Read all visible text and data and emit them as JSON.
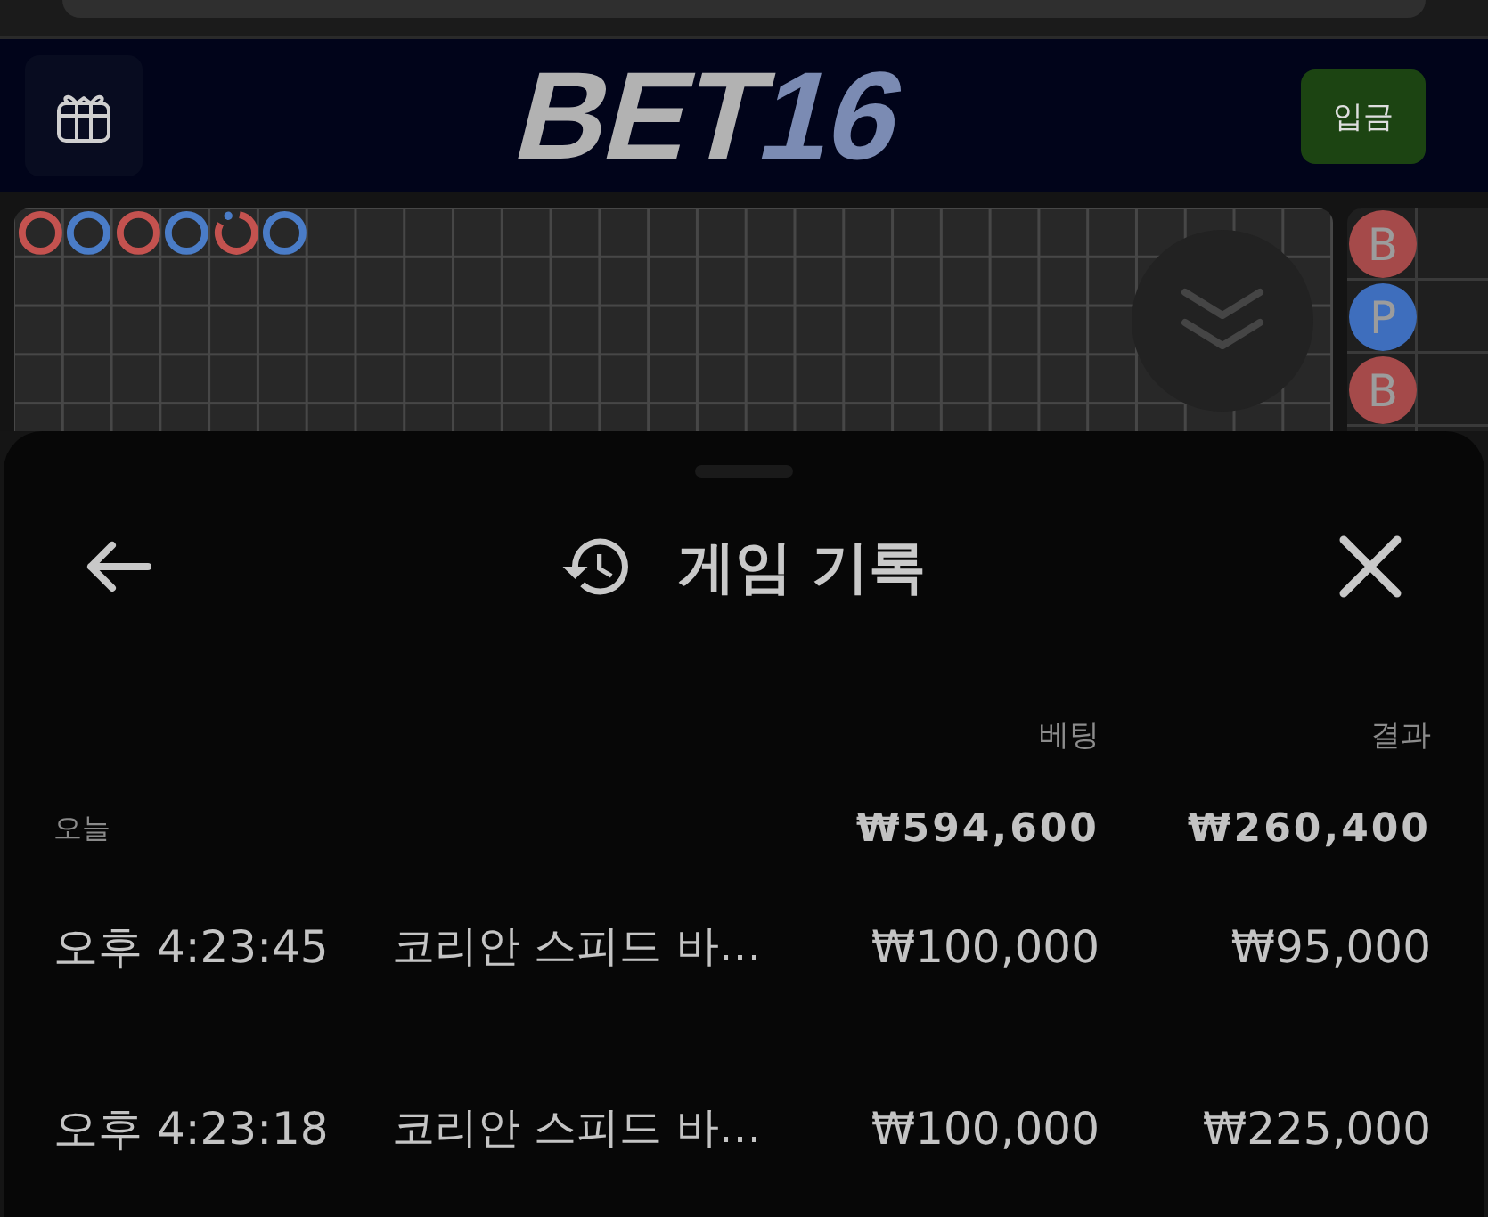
{
  "header": {
    "logo": [
      {
        "text": "BET",
        "kind": "primary"
      },
      {
        "text": "16",
        "kind": "accent"
      }
    ],
    "deposit_button": {
      "label": "입금"
    }
  },
  "big_road": {
    "marks": [
      {
        "color": "#c4524f",
        "pair": false
      },
      {
        "color": "#4a7cc7",
        "pair": false
      },
      {
        "color": "#c4524f",
        "pair": false
      },
      {
        "color": "#4a7cc7",
        "pair": false
      },
      {
        "color": "#c4524f",
        "pair": true
      },
      {
        "color": "#4a7cc7",
        "pair": false
      }
    ]
  },
  "bead_road": {
    "beads": [
      {
        "label": "B",
        "color": "#a54a4a"
      },
      {
        "label": "P",
        "color": "#3e6ebd"
      },
      {
        "label": "B",
        "color": "#a54a4a"
      }
    ]
  },
  "history_sheet": {
    "title": "게임 기록",
    "columns": [
      {
        "label": "베팅"
      },
      {
        "label": "결과"
      }
    ],
    "groups": [
      {
        "label": "오늘",
        "bet_total": "₩594,600",
        "result_total": "₩260,400",
        "rows": [
          {
            "time": "오후 4:23:45",
            "game": "코리안 스피드 바…",
            "bet": "₩100,000",
            "result": "₩95,000"
          },
          {
            "time": "오후 4:23:18",
            "game": "코리안 스피드 바…",
            "bet": "₩100,000",
            "result": "₩225,000"
          }
        ]
      }
    ]
  }
}
